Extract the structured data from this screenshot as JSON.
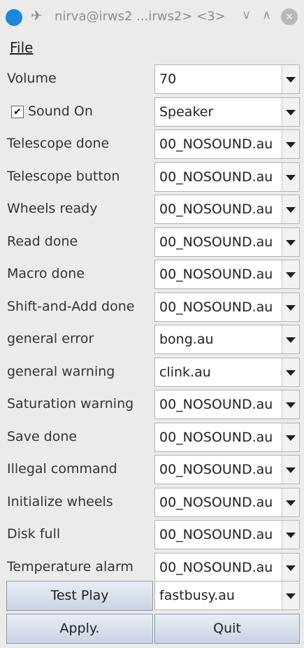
{
  "window": {
    "title": "nirva@irws2 ...irws2> <3>",
    "minimize_glyph": "∨",
    "maximize_glyph": "∧",
    "close_glyph": "×"
  },
  "menu": {
    "file": "File"
  },
  "settings": [
    {
      "label": "Volume",
      "value": "70"
    },
    {
      "label": "Sound On",
      "value": "Speaker",
      "checkbox": true,
      "checked": "✔"
    },
    {
      "label": "Telescope done",
      "value": "00_NOSOUND.au"
    },
    {
      "label": "Telescope button",
      "value": "00_NOSOUND.au"
    },
    {
      "label": "Wheels ready",
      "value": "00_NOSOUND.au"
    },
    {
      "label": "Read done",
      "value": "00_NOSOUND.au"
    },
    {
      "label": "Macro done",
      "value": "00_NOSOUND.au"
    },
    {
      "label": "Shift-and-Add done",
      "value": "00_NOSOUND.au"
    },
    {
      "label": "general error",
      "value": "bong.au"
    },
    {
      "label": "general warning",
      "value": "clink.au"
    },
    {
      "label": "Saturation warning",
      "value": "00_NOSOUND.au"
    },
    {
      "label": "Save done",
      "value": "00_NOSOUND.au"
    },
    {
      "label": "Illegal command",
      "value": "00_NOSOUND.au"
    },
    {
      "label": "Initialize wheels",
      "value": "00_NOSOUND.au"
    },
    {
      "label": "Disk full",
      "value": "00_NOSOUND.au"
    },
    {
      "label": "Temperature alarm",
      "value": "00_NOSOUND.au"
    }
  ],
  "test_play": {
    "label": "Test Play",
    "value": "fastbusy.au"
  },
  "actions": {
    "apply": "Apply.",
    "quit": "Quit"
  }
}
